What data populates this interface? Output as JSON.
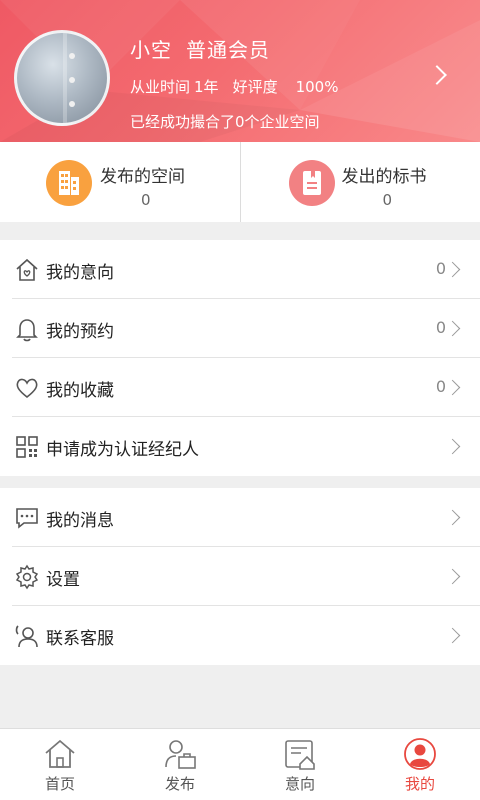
{
  "profile": {
    "name": "小空",
    "level": "普通会员",
    "tenure_label": "从业时间",
    "tenure_value": "1年",
    "rating_label": "好评度",
    "rating_value": "100%",
    "summary": "已经成功撮合了0个企业空间"
  },
  "stats": [
    {
      "label": "发布的空间",
      "count": "0",
      "icon": "building-icon",
      "color": "#f9a13f"
    },
    {
      "label": "发出的标书",
      "count": "0",
      "icon": "document-icon",
      "color": "#f28183"
    }
  ],
  "menu_group_1": [
    {
      "label": "我的意向",
      "count": "0",
      "icon": "home-heart-icon"
    },
    {
      "label": "我的预约",
      "count": "0",
      "icon": "bell-icon"
    },
    {
      "label": "我的收藏",
      "count": "0",
      "icon": "heart-icon"
    },
    {
      "label": "申请成为认证经纪人",
      "icon": "qr-code-icon"
    }
  ],
  "menu_group_2": [
    {
      "label": "我的消息",
      "icon": "message-icon"
    },
    {
      "label": "设置",
      "icon": "gear-icon"
    },
    {
      "label": "联系客服",
      "icon": "headset-icon"
    }
  ],
  "tabs": [
    {
      "label": "首页",
      "icon": "home-icon",
      "active": false
    },
    {
      "label": "发布",
      "icon": "publish-icon",
      "active": false
    },
    {
      "label": "意向",
      "icon": "intent-icon",
      "active": false
    },
    {
      "label": "我的",
      "icon": "user-icon",
      "active": true
    }
  ],
  "colors": {
    "accent": "#e8483f",
    "header_start": "#ef5964",
    "header_end": "#f9898a"
  }
}
